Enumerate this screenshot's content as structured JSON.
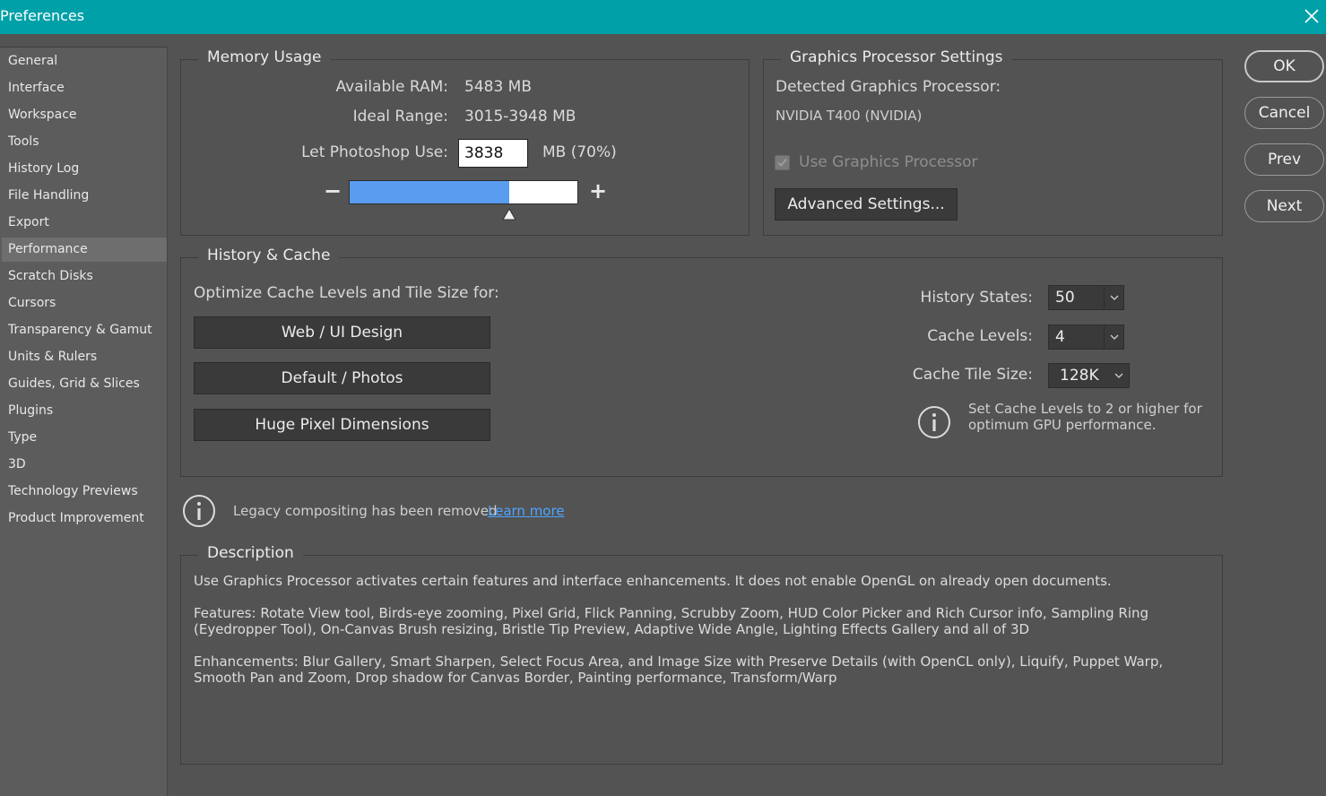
{
  "window": {
    "title": "Preferences"
  },
  "sidebar": {
    "items": [
      {
        "label": "General"
      },
      {
        "label": "Interface"
      },
      {
        "label": "Workspace"
      },
      {
        "label": "Tools"
      },
      {
        "label": "History Log"
      },
      {
        "label": "File Handling"
      },
      {
        "label": "Export"
      },
      {
        "label": "Performance",
        "selected": true
      },
      {
        "label": "Scratch Disks"
      },
      {
        "label": "Cursors"
      },
      {
        "label": "Transparency & Gamut"
      },
      {
        "label": "Units & Rulers"
      },
      {
        "label": "Guides, Grid & Slices"
      },
      {
        "label": "Plugins"
      },
      {
        "label": "Type"
      },
      {
        "label": "3D"
      },
      {
        "label": "Technology Previews"
      },
      {
        "label": "Product Improvement"
      }
    ]
  },
  "memory": {
    "title": "Memory Usage",
    "available_label": "Available RAM:",
    "available_value": "5483 MB",
    "ideal_label": "Ideal Range:",
    "ideal_value": "3015-3948 MB",
    "use_label": "Let Photoshop Use:",
    "use_value": "3838",
    "use_suffix": "MB (70%)",
    "slider_fraction": 0.7,
    "minus": "−",
    "plus": "+"
  },
  "gpu": {
    "title": "Graphics Processor Settings",
    "detected_label": "Detected Graphics Processor:",
    "detected_value": "NVIDIA T400 (NVIDIA)",
    "use_gpu_label": "Use Graphics Processor",
    "use_gpu_checked": true,
    "advanced_label": "Advanced Settings..."
  },
  "history_cache": {
    "title": "History & Cache",
    "optimize_label": "Optimize Cache Levels and Tile Size for:",
    "preset_buttons": [
      "Web / UI Design",
      "Default / Photos",
      "Huge Pixel Dimensions"
    ],
    "history_states_label": "History States:",
    "history_states_value": "50",
    "cache_levels_label": "Cache Levels:",
    "cache_levels_value": "4",
    "cache_tile_label": "Cache Tile Size:",
    "cache_tile_value": "128K",
    "info_text": "Set Cache Levels to 2 or higher for optimum GPU performance."
  },
  "legacy": {
    "text": "Legacy compositing has been removed",
    "link": "Learn more"
  },
  "description": {
    "title": "Description",
    "p1": "Use Graphics Processor activates certain features and interface enhancements. It does not enable OpenGL on already open documents.",
    "p2": "Features: Rotate View tool, Birds-eye zooming, Pixel Grid, Flick Panning, Scrubby Zoom, HUD Color Picker and Rich Cursor info, Sampling Ring (Eyedropper Tool), On-Canvas Brush resizing, Bristle Tip Preview, Adaptive Wide Angle, Lighting Effects Gallery and all of 3D",
    "p3": "Enhancements: Blur Gallery, Smart Sharpen, Select Focus Area, and Image Size with Preserve Details (with OpenCL only), Liquify, Puppet Warp, Smooth Pan and Zoom, Drop shadow for Canvas Border, Painting performance, Transform/Warp"
  },
  "actions": {
    "ok": "OK",
    "cancel": "Cancel",
    "prev": "Prev",
    "next": "Next"
  },
  "colors": {
    "titlebar": "#00a0a8",
    "panel": "#535353",
    "slider_fill": "#5a9cf0",
    "link": "#4ea5ff"
  }
}
